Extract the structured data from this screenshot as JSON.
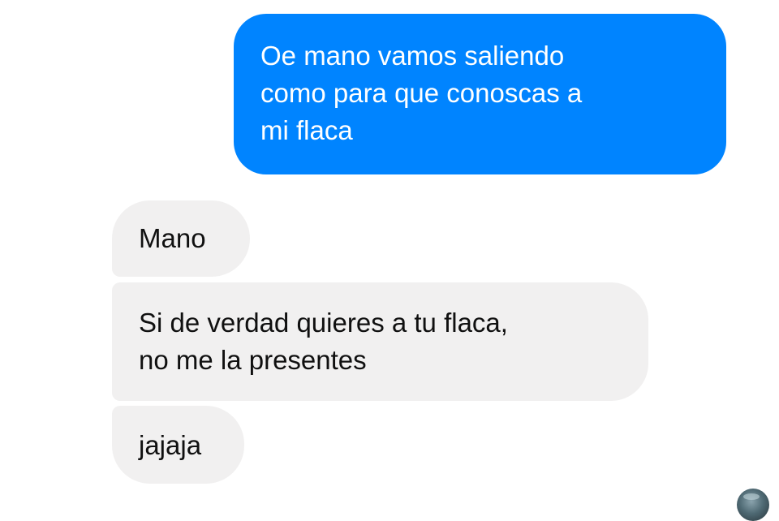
{
  "conversation": {
    "messages": [
      {
        "direction": "sent",
        "text": "Oe mano vamos saliendo\ncomo para que conoscas a\nmi flaca"
      },
      {
        "direction": "received",
        "text": "Mano"
      },
      {
        "direction": "received",
        "text": "Si de verdad quieres a tu flaca,\nno me la presentes"
      },
      {
        "direction": "received",
        "text": "jajaja"
      }
    ],
    "read_receipt": {
      "icon": "avatar-icon"
    }
  },
  "colors": {
    "sent_bubble": "#0084ff",
    "sent_text": "#ffffff",
    "received_bubble": "#f1f0f0",
    "received_text": "#101010"
  }
}
